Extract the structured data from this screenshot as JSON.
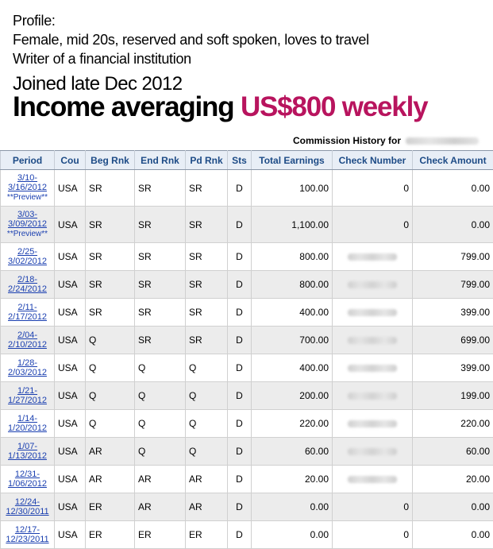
{
  "profile": {
    "label": "Profile:",
    "line1": "Female, mid 20s, reserved and soft spoken, loves to travel",
    "line2": "Writer of a financial institution"
  },
  "joined": "Joined late Dec 2012",
  "income": {
    "prefix": "Income averaging ",
    "amount": "US$800 weekly"
  },
  "table": {
    "title": "Commission History for",
    "headers": [
      "Period",
      "Cou",
      "Beg Rnk",
      "End Rnk",
      "Pd Rnk",
      "Sts",
      "Total Earnings",
      "Check Number",
      "Check Amount"
    ],
    "rows": [
      {
        "p1": "3/10-",
        "p2": "3/16/2012",
        "preview": "**Preview**",
        "cou": "USA",
        "beg": "SR",
        "end": "SR",
        "pd": "SR",
        "sts": "D",
        "total": "100.00",
        "check_no": "0",
        "check_amt": "0.00"
      },
      {
        "p1": "3/03-",
        "p2": "3/09/2012",
        "preview": "**Preview**",
        "cou": "USA",
        "beg": "SR",
        "end": "SR",
        "pd": "SR",
        "sts": "D",
        "total": "1,100.00",
        "check_no": "0",
        "check_amt": "0.00"
      },
      {
        "p1": "2/25-",
        "p2": "3/02/2012",
        "cou": "USA",
        "beg": "SR",
        "end": "SR",
        "pd": "SR",
        "sts": "D",
        "total": "800.00",
        "check_no": "",
        "check_amt": "799.00"
      },
      {
        "p1": "2/18-",
        "p2": "2/24/2012",
        "cou": "USA",
        "beg": "SR",
        "end": "SR",
        "pd": "SR",
        "sts": "D",
        "total": "800.00",
        "check_no": "",
        "check_amt": "799.00"
      },
      {
        "p1": "2/11-",
        "p2": "2/17/2012",
        "cou": "USA",
        "beg": "SR",
        "end": "SR",
        "pd": "SR",
        "sts": "D",
        "total": "400.00",
        "check_no": "",
        "check_amt": "399.00"
      },
      {
        "p1": "2/04-",
        "p2": "2/10/2012",
        "cou": "USA",
        "beg": "Q",
        "end": "SR",
        "pd": "SR",
        "sts": "D",
        "total": "700.00",
        "check_no": "",
        "check_amt": "699.00"
      },
      {
        "p1": "1/28-",
        "p2": "2/03/2012",
        "cou": "USA",
        "beg": "Q",
        "end": "Q",
        "pd": "Q",
        "sts": "D",
        "total": "400.00",
        "check_no": "",
        "check_amt": "399.00"
      },
      {
        "p1": "1/21-",
        "p2": "1/27/2012",
        "cou": "USA",
        "beg": "Q",
        "end": "Q",
        "pd": "Q",
        "sts": "D",
        "total": "200.00",
        "check_no": "",
        "check_amt": "199.00"
      },
      {
        "p1": "1/14-",
        "p2": "1/20/2012",
        "cou": "USA",
        "beg": "Q",
        "end": "Q",
        "pd": "Q",
        "sts": "D",
        "total": "220.00",
        "check_no": "",
        "check_amt": "220.00"
      },
      {
        "p1": "1/07-",
        "p2": "1/13/2012",
        "cou": "USA",
        "beg": "AR",
        "end": "Q",
        "pd": "Q",
        "sts": "D",
        "total": "60.00",
        "check_no": "",
        "check_amt": "60.00"
      },
      {
        "p1": "12/31-",
        "p2": "1/06/2012",
        "cou": "USA",
        "beg": "AR",
        "end": "AR",
        "pd": "AR",
        "sts": "D",
        "total": "20.00",
        "check_no": "",
        "check_amt": "20.00"
      },
      {
        "p1": "12/24-",
        "p2": "12/30/2011",
        "cou": "USA",
        "beg": "ER",
        "end": "AR",
        "pd": "AR",
        "sts": "D",
        "total": "0.00",
        "check_no": "0",
        "check_amt": "0.00"
      },
      {
        "p1": "12/17-",
        "p2": "12/23/2011",
        "cou": "USA",
        "beg": "ER",
        "end": "ER",
        "pd": "ER",
        "sts": "D",
        "total": "0.00",
        "check_no": "0",
        "check_amt": "0.00"
      }
    ]
  }
}
